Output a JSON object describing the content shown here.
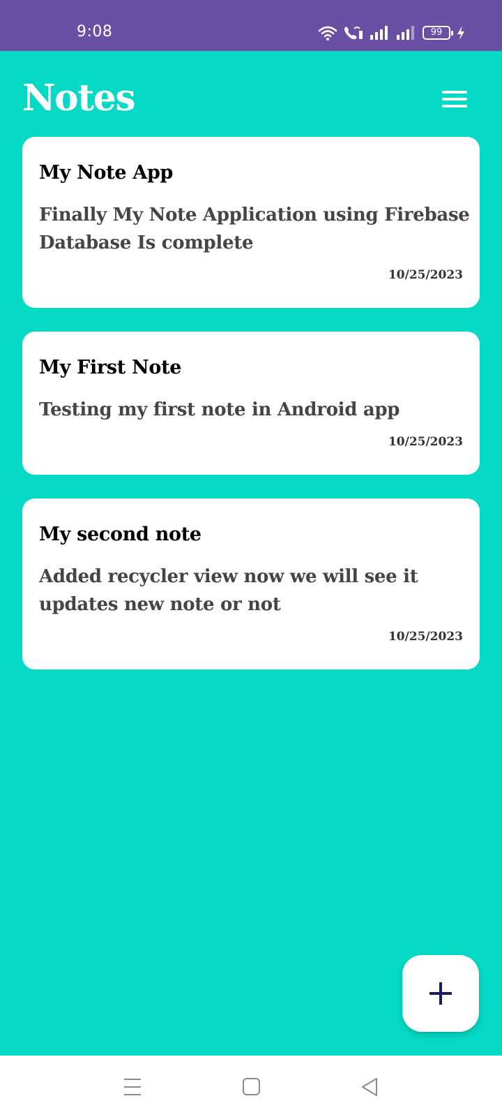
{
  "status_bar": {
    "time": "9:08",
    "battery": "99",
    "icons": [
      "wifi-icon",
      "wifi-call-icon",
      "signal-icon",
      "signal-icon",
      "battery-icon",
      "charging-icon"
    ]
  },
  "header": {
    "title": "Notes",
    "menu_icon": "hamburger-menu-icon"
  },
  "notes": [
    {
      "title": "My Note App",
      "body": "Finally My Note Application using Firebase Database Is complete",
      "date": "10/25/2023"
    },
    {
      "title": "My First Note",
      "body": "Testing my first note in Android app",
      "date": "10/25/2023"
    },
    {
      "title": "My second note",
      "body": "Added recycler view now we will see it updates new note or not",
      "date": "10/25/2023"
    }
  ],
  "fab": {
    "icon": "plus-icon"
  },
  "nav_bar": {
    "icons": [
      "recents-icon",
      "home-icon",
      "back-icon"
    ]
  },
  "colors": {
    "status_bar": "#6b4fa5",
    "background": "#03d9c5",
    "card": "#ffffff",
    "fab_icon": "#1a1a5e"
  }
}
